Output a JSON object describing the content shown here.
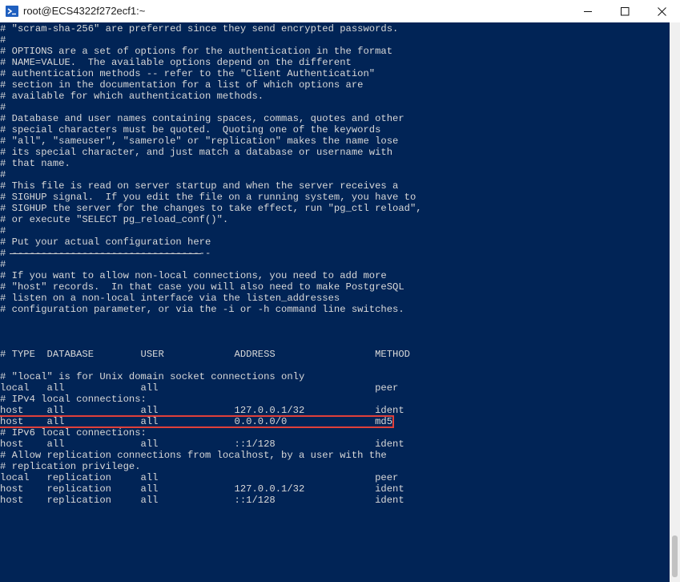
{
  "window": {
    "title": "root@ECS4322f272ecf1:~",
    "icons": {
      "app": "terminal-icon",
      "minimize": "minimize-icon",
      "maximize": "maximize-icon",
      "close": "close-icon"
    }
  },
  "colors": {
    "terminal_bg": "#012456",
    "terminal_fg": "#d8d8d8",
    "highlight_border": "#e0403a"
  },
  "terminal": {
    "lines": [
      "# \"scram-sha-256\" are preferred since they send encrypted passwords.",
      "#",
      "# OPTIONS are a set of options for the authentication in the format",
      "# NAME=VALUE.  The available options depend on the different",
      "# authentication methods -- refer to the \"Client Authentication\"",
      "# section in the documentation for a list of which options are",
      "# available for which authentication methods.",
      "#",
      "# Database and user names containing spaces, commas, quotes and other",
      "# special characters must be quoted.  Quoting one of the keywords",
      "# \"all\", \"sameuser\", \"samerole\" or \"replication\" makes the name lose",
      "# its special character, and just match a database or username with",
      "# that name.",
      "#",
      "# This file is read on server startup and when the server receives a",
      "# SIGHUP signal.  If you edit the file on a running system, you have to",
      "# SIGHUP the server for the changes to take effect, run \"pg_ctl reload\",",
      "# or execute \"SELECT pg_reload_conf()\".",
      "#",
      "# Put your actual configuration here",
      "# ----------------------------------",
      "#",
      "# If you want to allow non-local connections, you need to add more",
      "# \"host\" records.  In that case you will also need to make PostgreSQL",
      "# listen on a non-local interface via the listen_addresses",
      "# configuration parameter, or via the -i or -h command line switches.",
      "",
      "",
      "",
      "# TYPE  DATABASE        USER            ADDRESS                 METHOD",
      "",
      "# \"local\" is for Unix domain socket connections only",
      "local   all             all                                     peer",
      "# IPv4 local connections:",
      "host    all             all             127.0.0.1/32            ident",
      "host    all             all             0.0.0.0/0               md5",
      "# IPv6 local connections:",
      "host    all             all             ::1/128                 ident",
      "# Allow replication connections from localhost, by a user with the",
      "# replication privilege.",
      "local   replication     all                                     peer",
      "host    replication     all             127.0.0.1/32            ident",
      "host    replication     all             ::1/128                 ident"
    ]
  }
}
